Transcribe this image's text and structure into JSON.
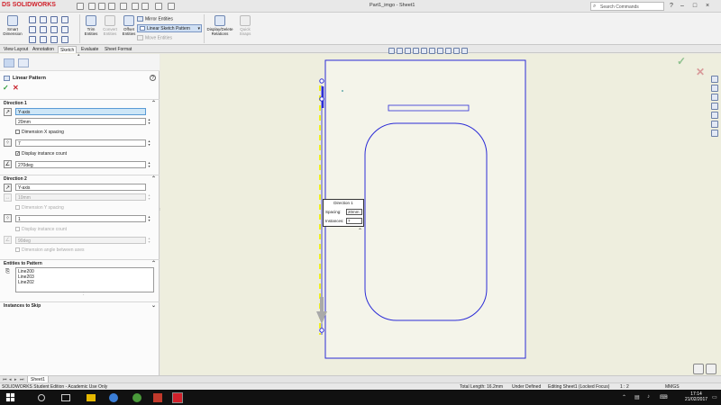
{
  "app": {
    "logo": "SOLIDWORKS",
    "brand_mark": "DS",
    "doc_title": "Part1_imgo - Sheet1",
    "search_placeholder": "Search Commands"
  },
  "command_manager": {
    "smart_dimension": "Smart Dimension",
    "trim_entities": "Trim Entities",
    "convert_entities": "Convert Entities",
    "offset_entities": "Offset Entities",
    "mirror_entities": "Mirror Entities",
    "linear_sketch_pattern": "Linear Sketch Pattern",
    "move_entities": "Move Entities",
    "display_delete_relations": "Display/Delete Relations",
    "quick_snaps": "Quick Snaps"
  },
  "tabs": [
    "View Layout",
    "Annotation",
    "Sketch",
    "Evaluate",
    "Sheet Format"
  ],
  "active_tab": "Sketch",
  "property_manager": {
    "title": "Linear Pattern",
    "direction1": {
      "title": "Direction 1",
      "axis": "Y-axis",
      "spacing": "20mm",
      "dimension_spacing": "Dimension X spacing",
      "instances": "7",
      "display_instance_count": "Display instance count",
      "angle": "270deg"
    },
    "direction2": {
      "title": "Direction 2",
      "axis": "Y-axis",
      "spacing": "10mm",
      "dimension_spacing": "Dimension Y spacing",
      "instances": "1",
      "display_instance_count": "Display instance count",
      "angle": "90deg",
      "dimension_angle": "Dimension angle between axes"
    },
    "entities": {
      "title": "Entities to Pattern",
      "items": [
        "Line200",
        "Line203",
        "Line202"
      ]
    },
    "instances_to_skip": {
      "title": "Instances to Skip"
    }
  },
  "callout": {
    "title": "Direction 1",
    "spacing_label": "Spacing:",
    "spacing_value": "20mm",
    "instances_label": "Instances:",
    "instances_value": "7"
  },
  "sheet_tab": "Sheet1",
  "status_bar": {
    "edition": "SOLIDWORKS Student Edition - Academic Use Only",
    "total_length": "Total Length: 16.2mm",
    "state": "Under Defined",
    "editing": "Editing Sheet1 (Locked Focus)",
    "scale": "1 : 2",
    "units": "MMGS"
  },
  "clock": {
    "time": "17:14",
    "date": "21/02/2017"
  },
  "colors": {
    "sketch_blue": "#2b2bd6",
    "selected_yellow": "#f0f020",
    "graphics_bg": "#eeeede",
    "brand_red": "#d0202a"
  }
}
